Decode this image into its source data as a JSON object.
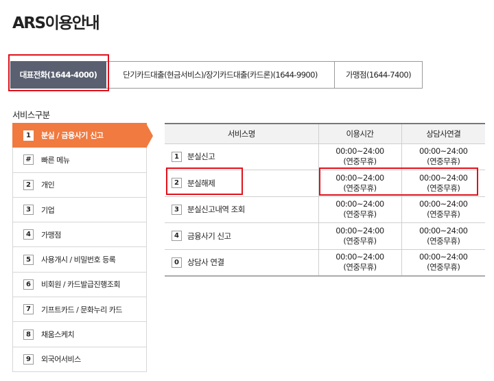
{
  "page": {
    "title": "ARS이용안내"
  },
  "tabs": [
    {
      "label": "대표전화(1644-4000)",
      "active": true
    },
    {
      "label": "단기카드대출(현금서비스)/장기카드대출(카드론)(1644-9900)",
      "active": false
    },
    {
      "label": "가맹점(1644-7400)",
      "active": false
    }
  ],
  "service_section": {
    "label": "서비스구분"
  },
  "menu": [
    {
      "num": "1",
      "label": "분실 / 금융사기 신고",
      "active": true
    },
    {
      "num": "#",
      "label": "빠른 메뉴"
    },
    {
      "num": "2",
      "label": "개인"
    },
    {
      "num": "3",
      "label": "기업"
    },
    {
      "num": "4",
      "label": "가맹점"
    },
    {
      "num": "5",
      "label": "사용개시 / 비밀번호 등록"
    },
    {
      "num": "6",
      "label": "비회원 / 카드발급진행조회"
    },
    {
      "num": "7",
      "label": "기프트카드 / 문화누리 카드"
    },
    {
      "num": "8",
      "label": "채움스케치"
    },
    {
      "num": "9",
      "label": "외국어서비스"
    }
  ],
  "table": {
    "headers": [
      "서비스명",
      "이용시간",
      "상담사연결"
    ],
    "rows": [
      {
        "num": "1",
        "name": "분실신고",
        "hours": [
          "00:00~24:00",
          "(연중무휴)"
        ],
        "agent": [
          "00:00~24:00",
          "(연중무휴)"
        ]
      },
      {
        "num": "2",
        "name": "분실해제",
        "hours": [
          "00:00~24:00",
          "(연중무휴)"
        ],
        "agent": [
          "00:00~24:00",
          "(연중무휴)"
        ]
      },
      {
        "num": "3",
        "name": "분실신고내역 조회",
        "hours": [
          "00:00~24:00",
          "(연중무휴)"
        ],
        "agent": [
          "00:00~24:00",
          "(연중무휴)"
        ]
      },
      {
        "num": "4",
        "name": "금융사기 신고",
        "hours": [
          "00:00~24:00",
          "(연중무휴)"
        ],
        "agent": [
          "00:00~24:00",
          "(연중무휴)"
        ]
      },
      {
        "num": "0",
        "name": "상담사 연결",
        "hours": [
          "00:00~24:00",
          "(연중무휴)"
        ],
        "agent": [
          "00:00~24:00",
          "(연중무휴)"
        ]
      }
    ]
  },
  "colors": {
    "active_tab": "#5a6070",
    "active_menu": "#f07a40",
    "highlight": "#e0101a"
  }
}
